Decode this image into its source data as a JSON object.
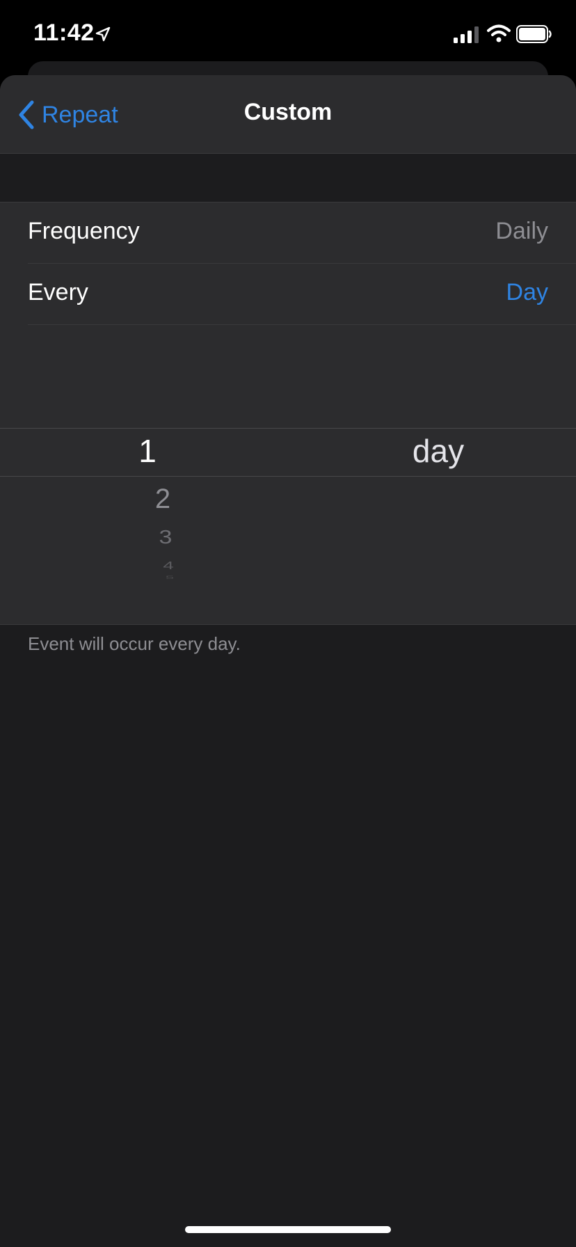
{
  "status_bar": {
    "time": "11:42",
    "icons": [
      "location-arrow-icon",
      "cellular-signal-icon",
      "wifi-icon",
      "battery-icon"
    ]
  },
  "nav": {
    "back_label": "Repeat",
    "title": "Custom"
  },
  "rows": [
    {
      "label": "Frequency",
      "value": "Daily",
      "value_color": "#8e8e93"
    },
    {
      "label": "Every",
      "value": "Day",
      "value_color": "#2f84e3"
    }
  ],
  "picker": {
    "selected_number": "1",
    "selected_unit": "day",
    "other_numbers": [
      "2",
      "3",
      "4",
      "5"
    ]
  },
  "footer": "Event will occur every day.",
  "colors": {
    "accent": "#2f84e3",
    "background": "#1c1c1e",
    "cell": "#2c2c2e",
    "secondary_text": "#8e8e93"
  }
}
